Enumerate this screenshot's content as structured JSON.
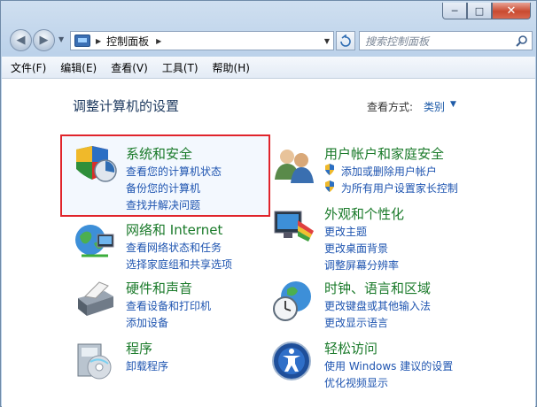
{
  "window": {
    "minimize": "─",
    "maximize": "□",
    "close": "✕"
  },
  "nav": {
    "back": "◀",
    "forward": "▶",
    "address_text": "控制面板",
    "search_placeholder": "搜索控制面板"
  },
  "menu": {
    "items": [
      "文件(F)",
      "编辑(E)",
      "查看(V)",
      "工具(T)",
      "帮助(H)"
    ]
  },
  "main": {
    "title": "调整计算机的设置",
    "view_by_label": "查看方式:",
    "view_by_value": "类别",
    "categories": [
      {
        "title": "系统和安全",
        "links": [
          "查看您的计算机状态",
          "备份您的计算机",
          "查找并解决问题"
        ]
      },
      {
        "title": "网络和 Internet",
        "links": [
          "查看网络状态和任务",
          "选择家庭组和共享选项"
        ]
      },
      {
        "title": "硬件和声音",
        "links": [
          "查看设备和打印机",
          "添加设备"
        ]
      },
      {
        "title": "程序",
        "links": [
          "卸载程序"
        ]
      },
      {
        "title": "用户帐户和家庭安全",
        "links": [
          "添加或删除用户帐户",
          "为所有用户设置家长控制"
        ]
      },
      {
        "title": "外观和个性化",
        "links": [
          "更改主题",
          "更改桌面背景",
          "调整屏幕分辨率"
        ]
      },
      {
        "title": "时钟、语言和区域",
        "links": [
          "更改键盘或其他输入法",
          "更改显示语言"
        ]
      },
      {
        "title": "轻松访问",
        "links": [
          "使用 Windows 建议的设置",
          "优化视频显示"
        ]
      }
    ]
  },
  "colors": {
    "category_title": "#1a7a2a",
    "link": "#1e54b0",
    "highlight_border": "#e0242b"
  }
}
